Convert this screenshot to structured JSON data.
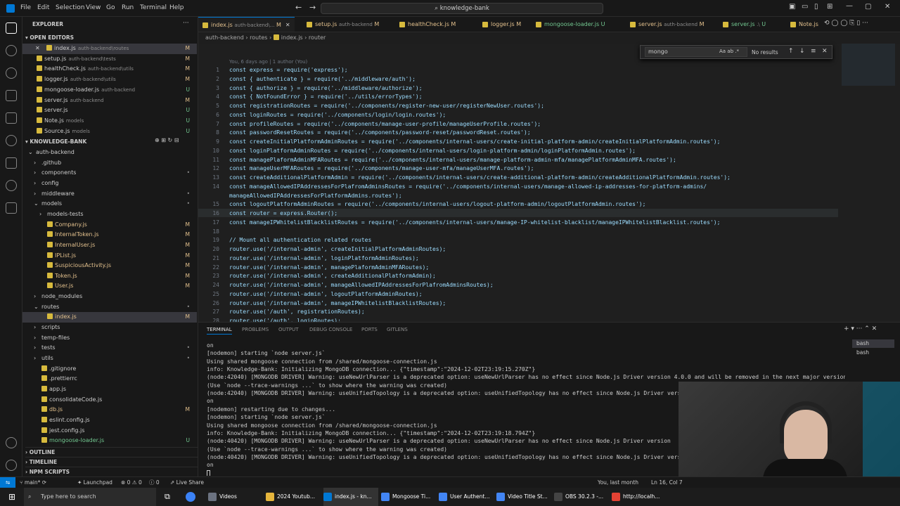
{
  "titlebar": {
    "menus": [
      "File",
      "Edit",
      "Selection",
      "View",
      "Go",
      "Run",
      "Terminal",
      "Help"
    ],
    "search": "knowledge-bank"
  },
  "sidebar": {
    "explorer_title": "EXPLORER",
    "open_editors_title": "OPEN EDITORS",
    "open_editors": [
      {
        "name": "index.js",
        "path": "auth-backend\\routes",
        "status": "M"
      },
      {
        "name": "setup.js",
        "path": "auth-backend\\tests",
        "status": "M"
      },
      {
        "name": "healthCheck.js",
        "path": "auth-backend\\utils",
        "status": "M"
      },
      {
        "name": "logger.js",
        "path": "auth-backend\\utils",
        "status": "M"
      },
      {
        "name": "mongoose-loader.js",
        "path": "auth-backend",
        "status": "U"
      },
      {
        "name": "server.js",
        "path": "auth-backend",
        "status": "M"
      },
      {
        "name": "server.js",
        "path": "",
        "status": "U"
      },
      {
        "name": "Note.js",
        "path": "models",
        "status": "U"
      },
      {
        "name": "Source.js",
        "path": "models",
        "status": "U"
      }
    ],
    "project_title": "KNOWLEDGE-BANK",
    "tree": [
      {
        "name": "auth-backend",
        "depth": 1,
        "folder": true,
        "open": true,
        "status": ""
      },
      {
        "name": ".github",
        "depth": 2,
        "folder": true,
        "status": ""
      },
      {
        "name": "components",
        "depth": 2,
        "folder": true,
        "status": "•"
      },
      {
        "name": "config",
        "depth": 2,
        "folder": true,
        "status": ""
      },
      {
        "name": "middleware",
        "depth": 2,
        "folder": true,
        "status": "•"
      },
      {
        "name": "models",
        "depth": 2,
        "folder": true,
        "open": true,
        "status": "•"
      },
      {
        "name": "models-tests",
        "depth": 3,
        "folder": true,
        "status": ""
      },
      {
        "name": "Company.js",
        "depth": 3,
        "status": "M"
      },
      {
        "name": "InternalToken.js",
        "depth": 3,
        "status": "M"
      },
      {
        "name": "InternalUser.js",
        "depth": 3,
        "status": "M"
      },
      {
        "name": "IPList.js",
        "depth": 3,
        "status": "M"
      },
      {
        "name": "SuspiciousActivity.js",
        "depth": 3,
        "status": "M"
      },
      {
        "name": "Token.js",
        "depth": 3,
        "status": "M"
      },
      {
        "name": "User.js",
        "depth": 3,
        "status": "M"
      },
      {
        "name": "node_modules",
        "depth": 2,
        "folder": true,
        "status": ""
      },
      {
        "name": "routes",
        "depth": 2,
        "folder": true,
        "open": true,
        "status": "•"
      },
      {
        "name": "index.js",
        "depth": 3,
        "status": "M",
        "selected": true
      },
      {
        "name": "scripts",
        "depth": 2,
        "folder": true,
        "status": ""
      },
      {
        "name": "temp-files",
        "depth": 2,
        "folder": true,
        "status": ""
      },
      {
        "name": "tests",
        "depth": 2,
        "folder": true,
        "status": "•"
      },
      {
        "name": "utils",
        "depth": 2,
        "folder": true,
        "status": "•"
      },
      {
        "name": ".gitignore",
        "depth": 2,
        "status": ""
      },
      {
        "name": ".prettierrc",
        "depth": 2,
        "status": ""
      },
      {
        "name": "app.js",
        "depth": 2,
        "status": ""
      },
      {
        "name": "consolidateCode.js",
        "depth": 2,
        "status": ""
      },
      {
        "name": "db.js",
        "depth": 2,
        "status": "M"
      },
      {
        "name": "eslint.config.js",
        "depth": 2,
        "status": ""
      },
      {
        "name": "jest.config.js",
        "depth": 2,
        "status": ""
      },
      {
        "name": "mongoose-loader.js",
        "depth": 2,
        "status": "U"
      }
    ],
    "outline": "OUTLINE",
    "timeline": "TIMELINE",
    "npm": "NPM SCRIPTS"
  },
  "tabs": [
    {
      "name": "index.js",
      "path": "auth-backend\\...",
      "status": "M",
      "active": true
    },
    {
      "name": "setup.js",
      "path": "auth-backend",
      "status": "M"
    },
    {
      "name": "healthCheck.js",
      "path": "",
      "status": "M"
    },
    {
      "name": "logger.js",
      "path": "",
      "status": "M"
    },
    {
      "name": "mongoose-loader.js",
      "path": "",
      "status": "U"
    },
    {
      "name": "server.js",
      "path": "auth-backend",
      "status": "M"
    },
    {
      "name": "server.js",
      "path": ".\\",
      "status": "U"
    },
    {
      "name": "Note.js",
      "path": "",
      "status": ""
    }
  ],
  "breadcrumb": [
    "auth-backend",
    "routes",
    "index.js",
    "router"
  ],
  "editor": {
    "blame": "You, 6 days ago | 1 author (You)",
    "lines": [
      {
        "n": "1",
        "t": "const express = require('express');"
      },
      {
        "n": "2",
        "t": "const { authenticate } = require('../middleware/auth');"
      },
      {
        "n": "3",
        "t": "const { authorize } = require('../middleware/authorize');"
      },
      {
        "n": "4",
        "t": "const { NotFoundError } = require('../utils/errorTypes');"
      },
      {
        "n": "5",
        "t": "const registrationRoutes = require('../components/register-new-user/registerNewUser.routes');"
      },
      {
        "n": "6",
        "t": "const loginRoutes = require('../components/login/login.routes');"
      },
      {
        "n": "7",
        "t": "const profileRoutes = require('../components/manage-user-profile/manageUserProfile.routes');"
      },
      {
        "n": "8",
        "t": "const passwordResetRoutes = require('../components/password-reset/passwordReset.routes');"
      },
      {
        "n": "9",
        "t": "const createInitialPlatformAdminRoutes = require('../components/internal-users/create-initial-platform-admin/createInitialPlatformAdmin.routes');"
      },
      {
        "n": "10",
        "t": "const loginPlatformAdminRoutes = require('../components/internal-users/login-platform-admin/loginPlatformAdmin.routes');"
      },
      {
        "n": "11",
        "t": "const managePlaformAdminMFARoutes = require('../components/internal-users/manage-platform-admin-mfa/managePlatformAdminMFA.routes');"
      },
      {
        "n": "12",
        "t": "const manageUserMFARoutes = require('../components/manage-user-mfa/manageUserMFA.routes');"
      },
      {
        "n": "13",
        "t": "const createAdditionalPlatformAdmin = require('../components/internal-users/create-additional-platform-admin/createAdditionalPlatformAdmin.routes');"
      },
      {
        "n": "14",
        "t": "const manageAllowedIPAddressesForPlafromAdminsRoutes = require('../components/internal-users/manage-allowed-ip-addresses-for-platform-admins/"
      },
      {
        "n": "",
        "t": "manageAllowedIPAddressesForPlatformAdmins.routes');"
      },
      {
        "n": "15",
        "t": "const logoutPlatformAdminRoutes = require('../components/internal-users/logout-platform-admin/logoutPlatformAdmin.routes');"
      },
      {
        "n": "16",
        "t": "const router = express.Router();"
      },
      {
        "n": "17",
        "t": "const manageIPWhitelistBlacklistRoutes = require('../components/internal-users/manage-IP-whitelist-blacklist/manageIPWhitelistBlacklist.routes');"
      },
      {
        "n": "18",
        "t": ""
      },
      {
        "n": "19",
        "t": "// Mount all authentication related routes"
      },
      {
        "n": "20",
        "t": "router.use('/internal-admin', createInitialPlatformAdminRoutes);"
      },
      {
        "n": "21",
        "t": "router.use('/internal-admin', loginPlatformAdminRoutes);"
      },
      {
        "n": "22",
        "t": "router.use('/internal-admin', managePlaformAdminMFARoutes);"
      },
      {
        "n": "23",
        "t": "router.use('/internal-admin', createAdditionalPlatformAdmin);"
      },
      {
        "n": "24",
        "t": "router.use('/internal-admin', manageAllowedIPAddressesForPlafromAdminsRoutes);"
      },
      {
        "n": "25",
        "t": "router.use('/internal-admin', logoutPlatformAdminRoutes);"
      },
      {
        "n": "26",
        "t": "router.use('/internal-admin', manageIPWhitelistBlacklistRoutes);"
      },
      {
        "n": "27",
        "t": "router.use('/auth', registrationRoutes);"
      },
      {
        "n": "28",
        "t": "router.use('/auth', loginRoutes);"
      }
    ]
  },
  "find": {
    "query": "mongo",
    "result": "No results",
    "opts": "Aa  ab  .*"
  },
  "panel": {
    "tabs": [
      "TERMINAL",
      "PROBLEMS",
      "OUTPUT",
      "DEBUG CONSOLE",
      "PORTS",
      "GITLENS"
    ],
    "terminals": [
      "bash",
      "bash"
    ],
    "lines": [
      "on",
      "[nodemon] starting `node server.js`",
      "Using shared mongoose connection from /shared/mongoose-connection.js",
      "info: Knowledge-Bank: Initializing MongoDB connection... {\"timestamp\":\"2024-12-02T23:19:15.270Z\"}",
      "(node:42040) [MONGODB DRIVER] Warning: useNewUrlParser is a deprecated option: useNewUrlParser has no effect since Node.js Driver version 4.0.0 and will be removed in the next major version",
      "(Use `node --trace-warnings ...` to show where the warning was created)",
      "(node:42040) [MONGODB DRIVER] Warning: useUnifiedTopology is a deprecated option: useUnifiedTopology has no effect since Node.js Driver version",
      "on",
      "[nodemon] restarting due to changes...",
      "[nodemon] starting `node server.js`",
      "Using shared mongoose connection from /shared/mongoose-connection.js",
      "info: Knowledge-Bank: Initializing MongoDB connection... {\"timestamp\":\"2024-12-02T23:19:18.794Z\"}",
      "(node:40420) [MONGODB DRIVER] Warning: useNewUrlParser is a deprecated option: useNewUrlParser has no effect since Node.js Driver version",
      "(Use `node --trace-warnings ...` to show where the warning was created)",
      "(node:40420) [MONGODB DRIVER] Warning: useUnifiedTopology is a deprecated option: useUnifiedTopology has no effect since Node.js Driver version",
      "on"
    ]
  },
  "status": {
    "branch": "main*",
    "launchpad": "Launchpad",
    "errors": "0",
    "warnings": "0",
    "info": "0",
    "live": "Live Share",
    "blame": "You, last month",
    "position": "Ln 16, Col 7"
  },
  "taskbar": {
    "search": "Type here to search",
    "items": [
      "Videos",
      "2024 Youtub...",
      "index.js - kn...",
      "Mongoose Ti...",
      "User Authent...",
      "Video Title St...",
      "OBS 30.2.3 -...",
      "http://localh..."
    ]
  },
  "colors": {
    "accent": "#0078d4",
    "modified": "#e2c08d",
    "untracked": "#73c991"
  }
}
